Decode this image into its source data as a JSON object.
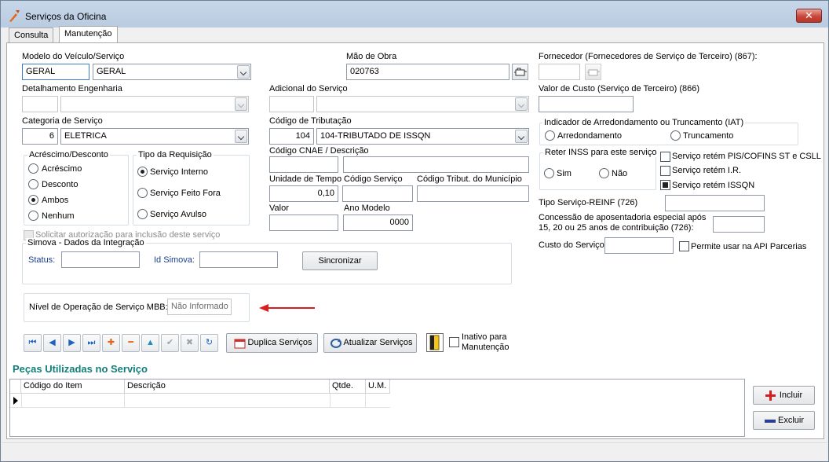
{
  "window": {
    "title": "Serviços da Oficina",
    "close_glyph": "✕"
  },
  "tabs": [
    {
      "label": "Consulta"
    },
    {
      "label": "Manutenção"
    }
  ],
  "form": {
    "modelo_label": "Modelo do Veículo/Serviço",
    "modelo_code": "GERAL",
    "modelo_name": "GERAL",
    "detalhamento_label": "Detalhamento Engenharia",
    "categoria_label": "Categoria de Serviço",
    "categoria_code": "6",
    "categoria_name": "ELETRICA",
    "mao_obra_label": "Mão de Obra",
    "mao_obra_value": "020763",
    "adicional_label": "Adicional do Serviço",
    "tributacao_label": "Código de Tributação",
    "tributacao_code": "104",
    "tributacao_name": "104-TRIBUTADO DE ISSQN",
    "cnae_label": "Código CNAE / Descrição",
    "unidade_tempo_label": "Unidade de Tempo",
    "unidade_tempo_value": "0,10",
    "codigo_servico_label": "Código Serviço",
    "codigo_trib_municipio_label": "Código Tribut. do Município",
    "valor_label": "Valor",
    "ano_modelo_label": "Ano Modelo",
    "ano_modelo_value": "0000",
    "acrescimo_group": "Acréscimo/Desconto",
    "acrescimo_options": [
      "Acréscimo",
      "Desconto",
      "Ambos",
      "Nenhum"
    ],
    "acrescimo_selected": "Ambos",
    "requisicao_group": "Tipo da Requisição",
    "requisicao_options": [
      "Serviço Interno",
      "Serviço Feito Fora",
      "Serviço Avulso"
    ],
    "requisicao_selected": "Serviço Interno",
    "solicitar_label": "Solicitar autorização para inclusão deste serviço",
    "simova_group": "Simova - Dados da Integração",
    "status_label": "Status:",
    "id_simova_label": "Id Simova:",
    "sincronizar_label": "Sincronizar",
    "nivel_label": "Nível de Operação de Serviço MBB:",
    "nivel_value": "Não Informado",
    "fornecedor_label": "Fornecedor (Fornecedores de Serviço de Terceiro) (867):",
    "valor_custo_label": "Valor de Custo (Serviço de Terceiro) (866)",
    "iat_group": "Indicador de Arredondamento ou Truncamento (IAT)",
    "iat_options": [
      "Arredondamento",
      "Truncamento"
    ],
    "inss_group": "Reter INSS para este serviço",
    "inss_options": [
      "Sim",
      "Não"
    ],
    "retem_pis_label": "Serviço retém PIS/COFINS ST e CSLL",
    "retem_ir_label": "Serviço retém I.R.",
    "retem_issqn_label": "Serviço retém ISSQN",
    "retem_issqn_checked": true,
    "tipo_reinf_label": "Tipo Serviço-REINF (726)",
    "concessao_label_1": "Concessão de aposentadoria especial após",
    "concessao_label_2": "15, 20 ou 25 anos de contribuição (726):",
    "custo_servico_label": "Custo do Serviço",
    "api_parcerias_label": "Permite usar na API Parcerias"
  },
  "toolbar": {
    "nav_glyphs": [
      "⏮",
      "◀",
      "▶",
      "⏭",
      "✚",
      "━",
      "▲",
      "✔",
      "✖",
      "↻"
    ],
    "duplica_label": "Duplica Serviços",
    "atualizar_label": "Atualizar Serviços",
    "inativo_label_1": "Inativo para",
    "inativo_label_2": "Manutenção"
  },
  "pecas": {
    "title": "Peças Utilizadas no Serviço",
    "columns": [
      "Código do Item",
      "Descrição",
      "Qtde.",
      "U.M."
    ],
    "incluir_label": "Incluir",
    "excluir_label": "Excluir"
  },
  "colors": {
    "accent_teal": "#117e78",
    "arrow_red": "#d92020",
    "title_bar": "#bfd0e4"
  }
}
